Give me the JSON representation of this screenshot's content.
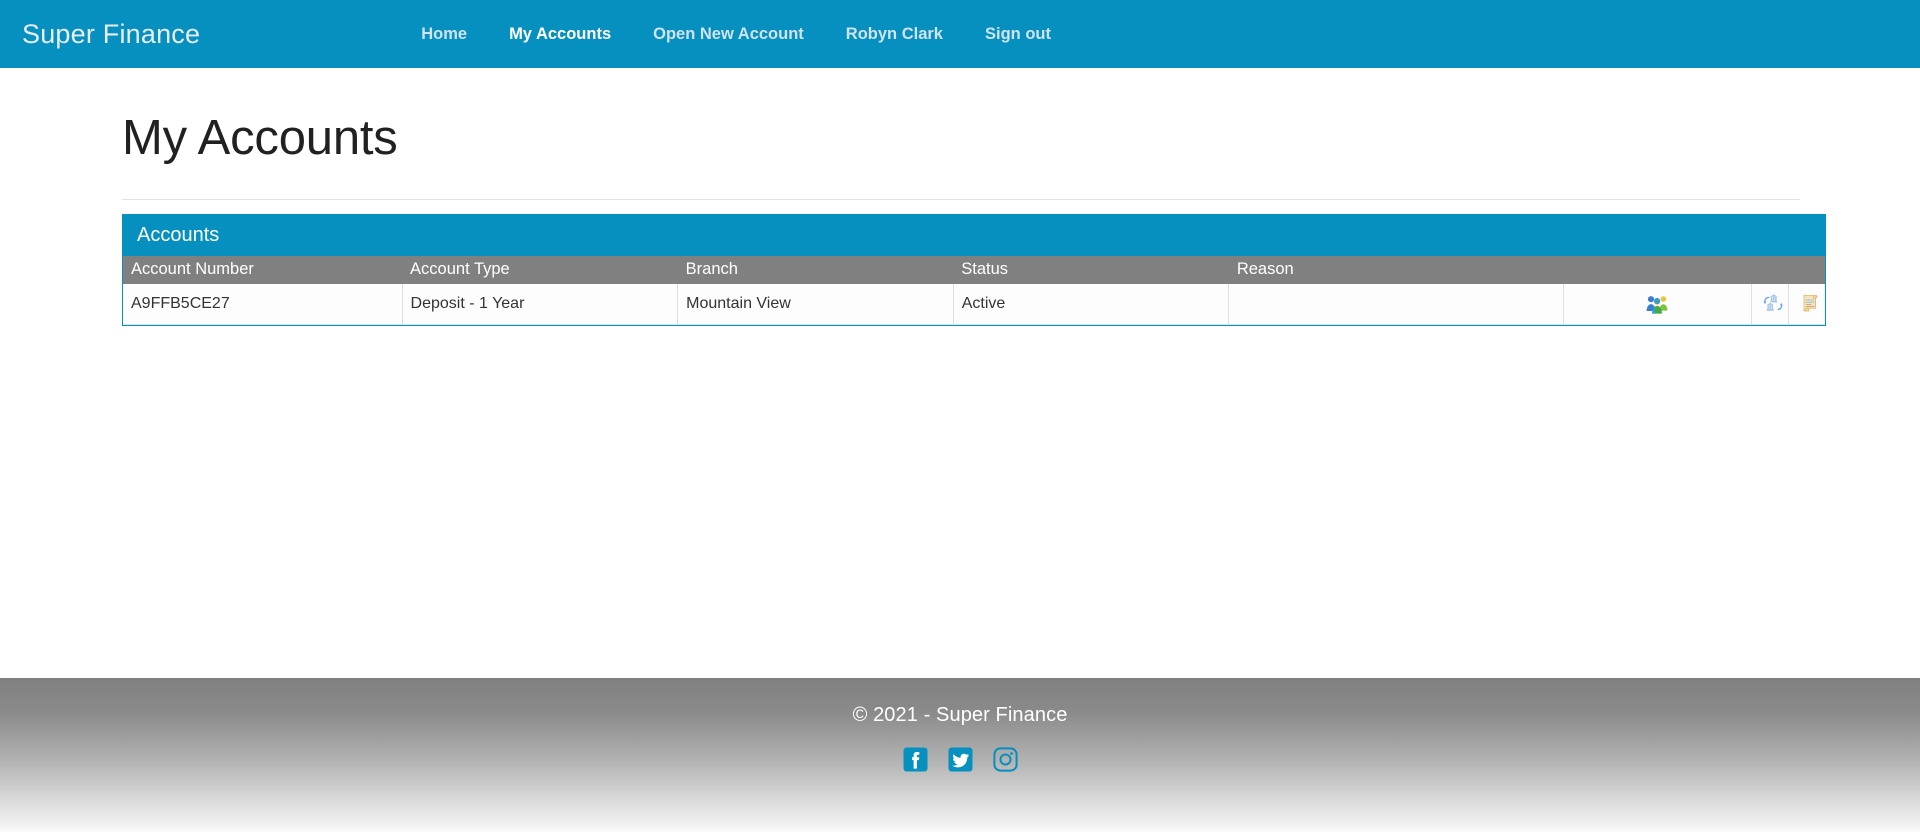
{
  "navbar": {
    "brand": "Super Finance",
    "links": [
      {
        "label": "Home",
        "active": false
      },
      {
        "label": "My Accounts",
        "active": true
      },
      {
        "label": "Open New Account",
        "active": false
      },
      {
        "label": "Robyn Clark",
        "active": false
      },
      {
        "label": "Sign out",
        "active": false
      }
    ],
    "background_color": "#0690bf"
  },
  "main": {
    "page_title": "My Accounts",
    "panel": {
      "heading": "Accounts",
      "heading_color": "#0690bf",
      "table": {
        "columns": [
          "Account Number",
          "Account Type",
          "Branch",
          "Status",
          "Reason"
        ],
        "header_color": "#808080",
        "rows": [
          {
            "account_number": "A9FFB5CE27",
            "account_type": "Deposit - 1 Year",
            "branch": "Mountain View",
            "status": "Active",
            "reason": "",
            "actions": [
              "account-holders-icon",
              "transfer-icon",
              "statement-icon"
            ]
          }
        ]
      }
    }
  },
  "footer": {
    "copyright": "© 2021 - Super Finance",
    "social": [
      {
        "name": "facebook-icon"
      },
      {
        "name": "twitter-icon"
      },
      {
        "name": "instagram-icon"
      }
    ],
    "social_color": "#0690bf"
  }
}
